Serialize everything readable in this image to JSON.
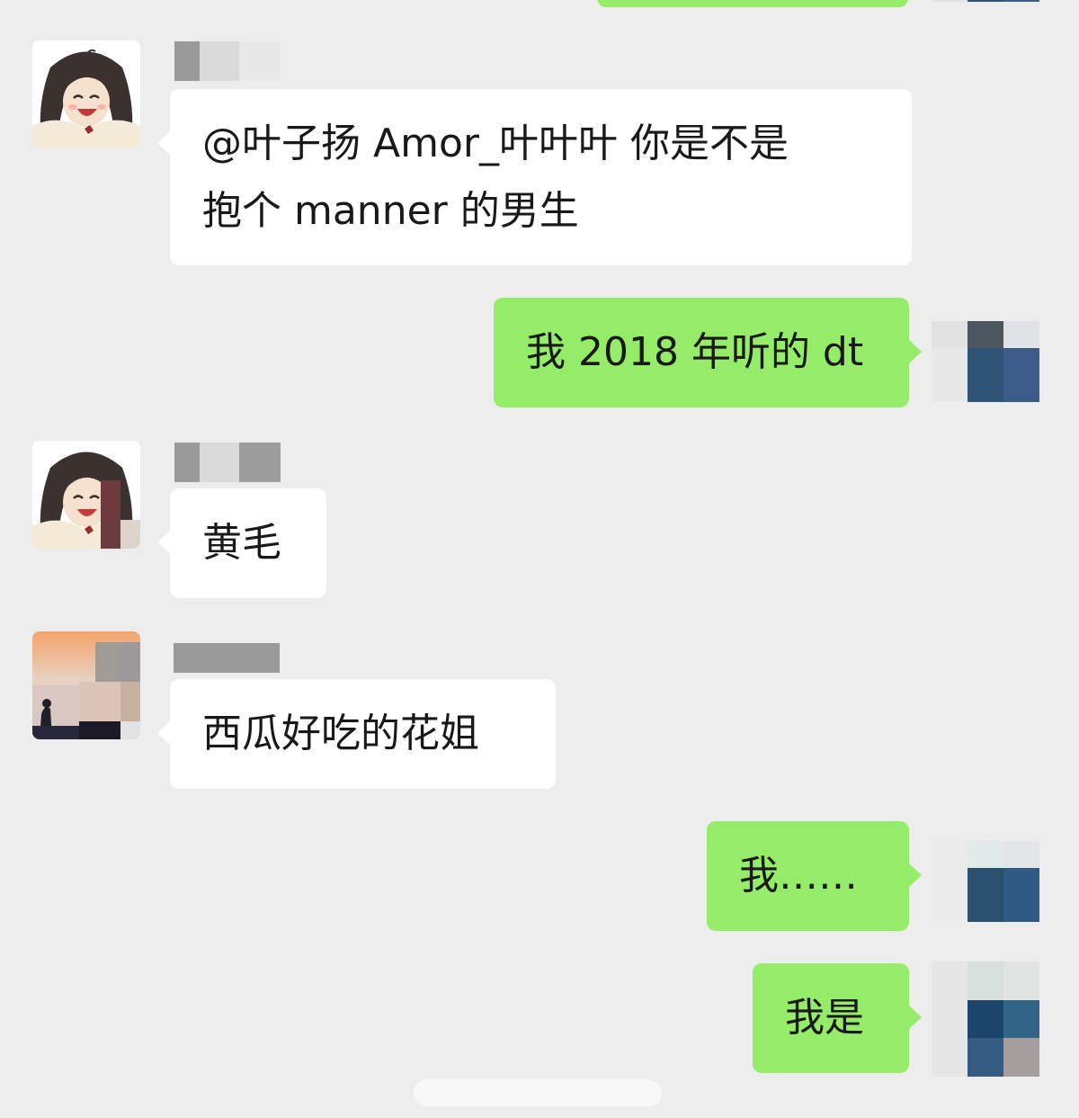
{
  "chat": {
    "messages": [
      {
        "side": "left",
        "sender_avatar": "girl-cartoon-avatar",
        "lines": [
          "@叶子扬  Amor_叶叶叶   你是不是",
          "抱个 manner 的男生"
        ]
      },
      {
        "side": "right",
        "sender_avatar": "pixelated-avatar",
        "text": "我 2018 年听的 dt"
      },
      {
        "side": "left",
        "sender_avatar": "girl-cartoon-avatar",
        "text": "黄毛"
      },
      {
        "side": "left",
        "sender_avatar": "sunset-photo-avatar",
        "text": "西瓜好吃的花姐"
      },
      {
        "side": "right",
        "sender_avatar": "pixelated-avatar",
        "text": "我……"
      },
      {
        "side": "right",
        "sender_avatar": "pixelated-avatar",
        "text": "我是"
      }
    ]
  },
  "colors": {
    "background": "#ededed",
    "bubble_left": "#ffffff",
    "bubble_right": "#95ec69",
    "text": "#191919"
  }
}
